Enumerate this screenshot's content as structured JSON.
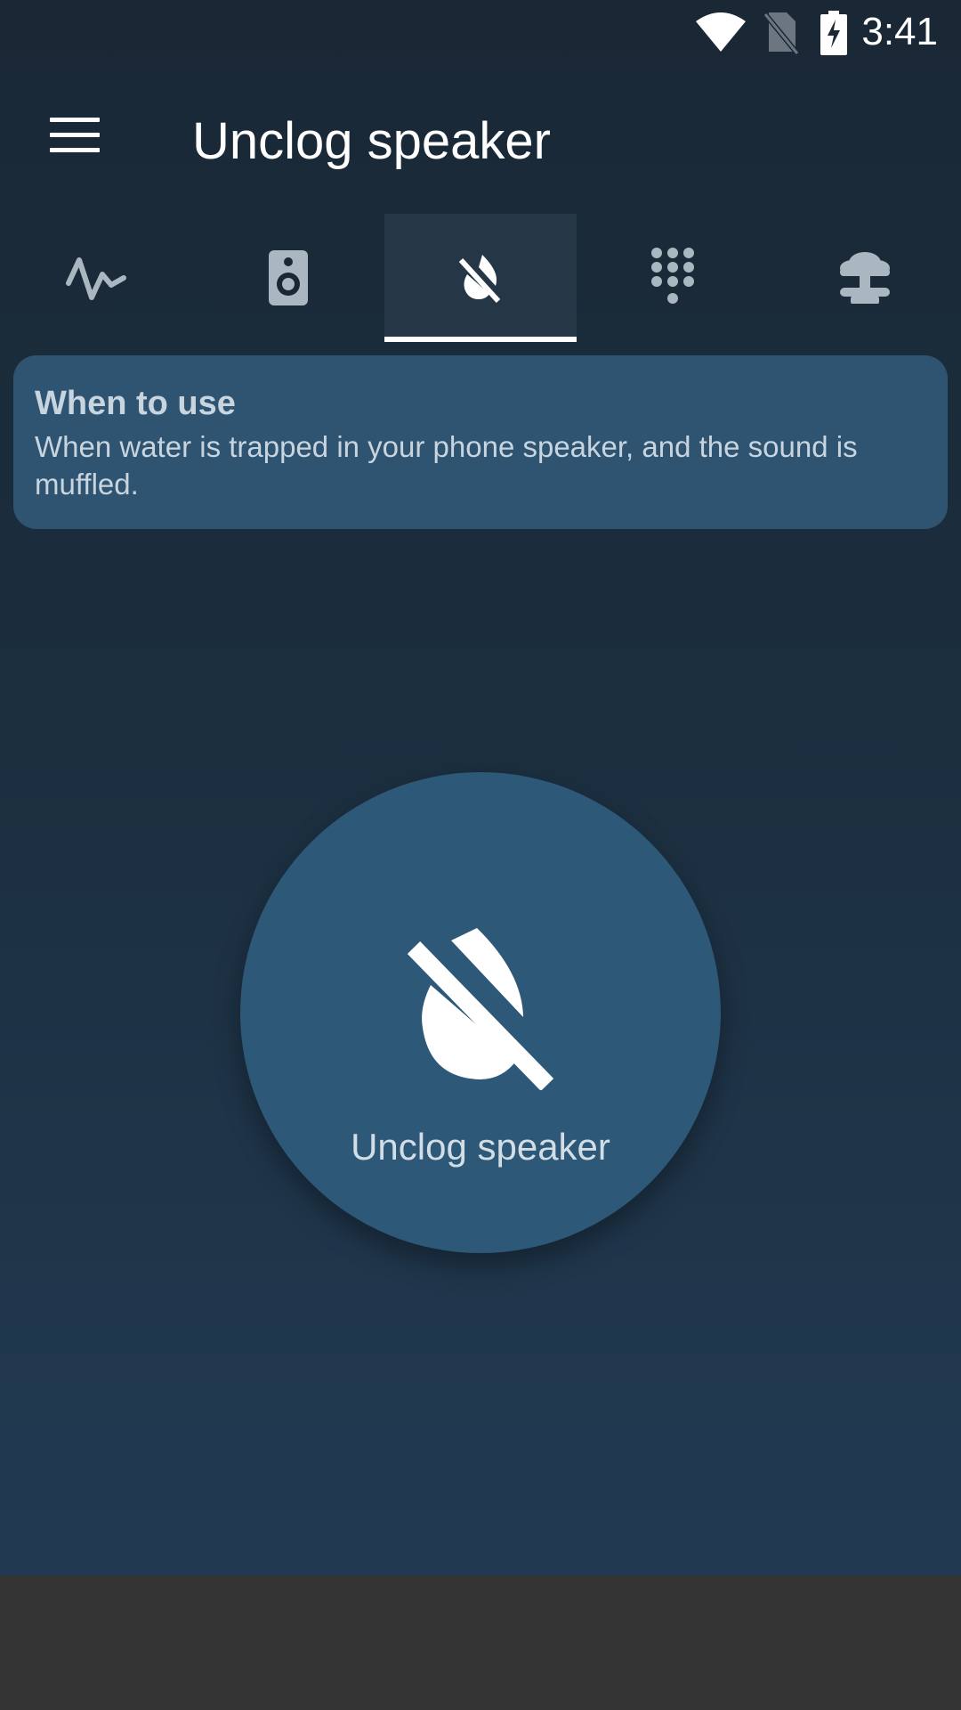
{
  "status_bar": {
    "time": "3:41",
    "icons": [
      "wifi-icon",
      "no-sim-icon",
      "battery-charging-icon"
    ]
  },
  "app_bar": {
    "menu_icon": "menu-icon",
    "title": "Unclog speaker"
  },
  "tabs": [
    {
      "icon": "waveform-icon",
      "active": false
    },
    {
      "icon": "speaker-icon",
      "active": false
    },
    {
      "icon": "water-off-icon",
      "active": true
    },
    {
      "icon": "dialpad-icon",
      "active": false
    },
    {
      "icon": "explosion-icon",
      "active": false
    }
  ],
  "info_card": {
    "title": "When to use",
    "text": "When water is trapped in your phone speaker, and the sound is muffled."
  },
  "main_button": {
    "icon": "water-off-icon",
    "label": "Unclog speaker"
  },
  "colors": {
    "background_top": "#1a2836",
    "background_bottom": "#213a52",
    "card": "#2e5472",
    "button": "#2e5878",
    "tab_active": "#253646",
    "nav_bar": "#333333"
  }
}
